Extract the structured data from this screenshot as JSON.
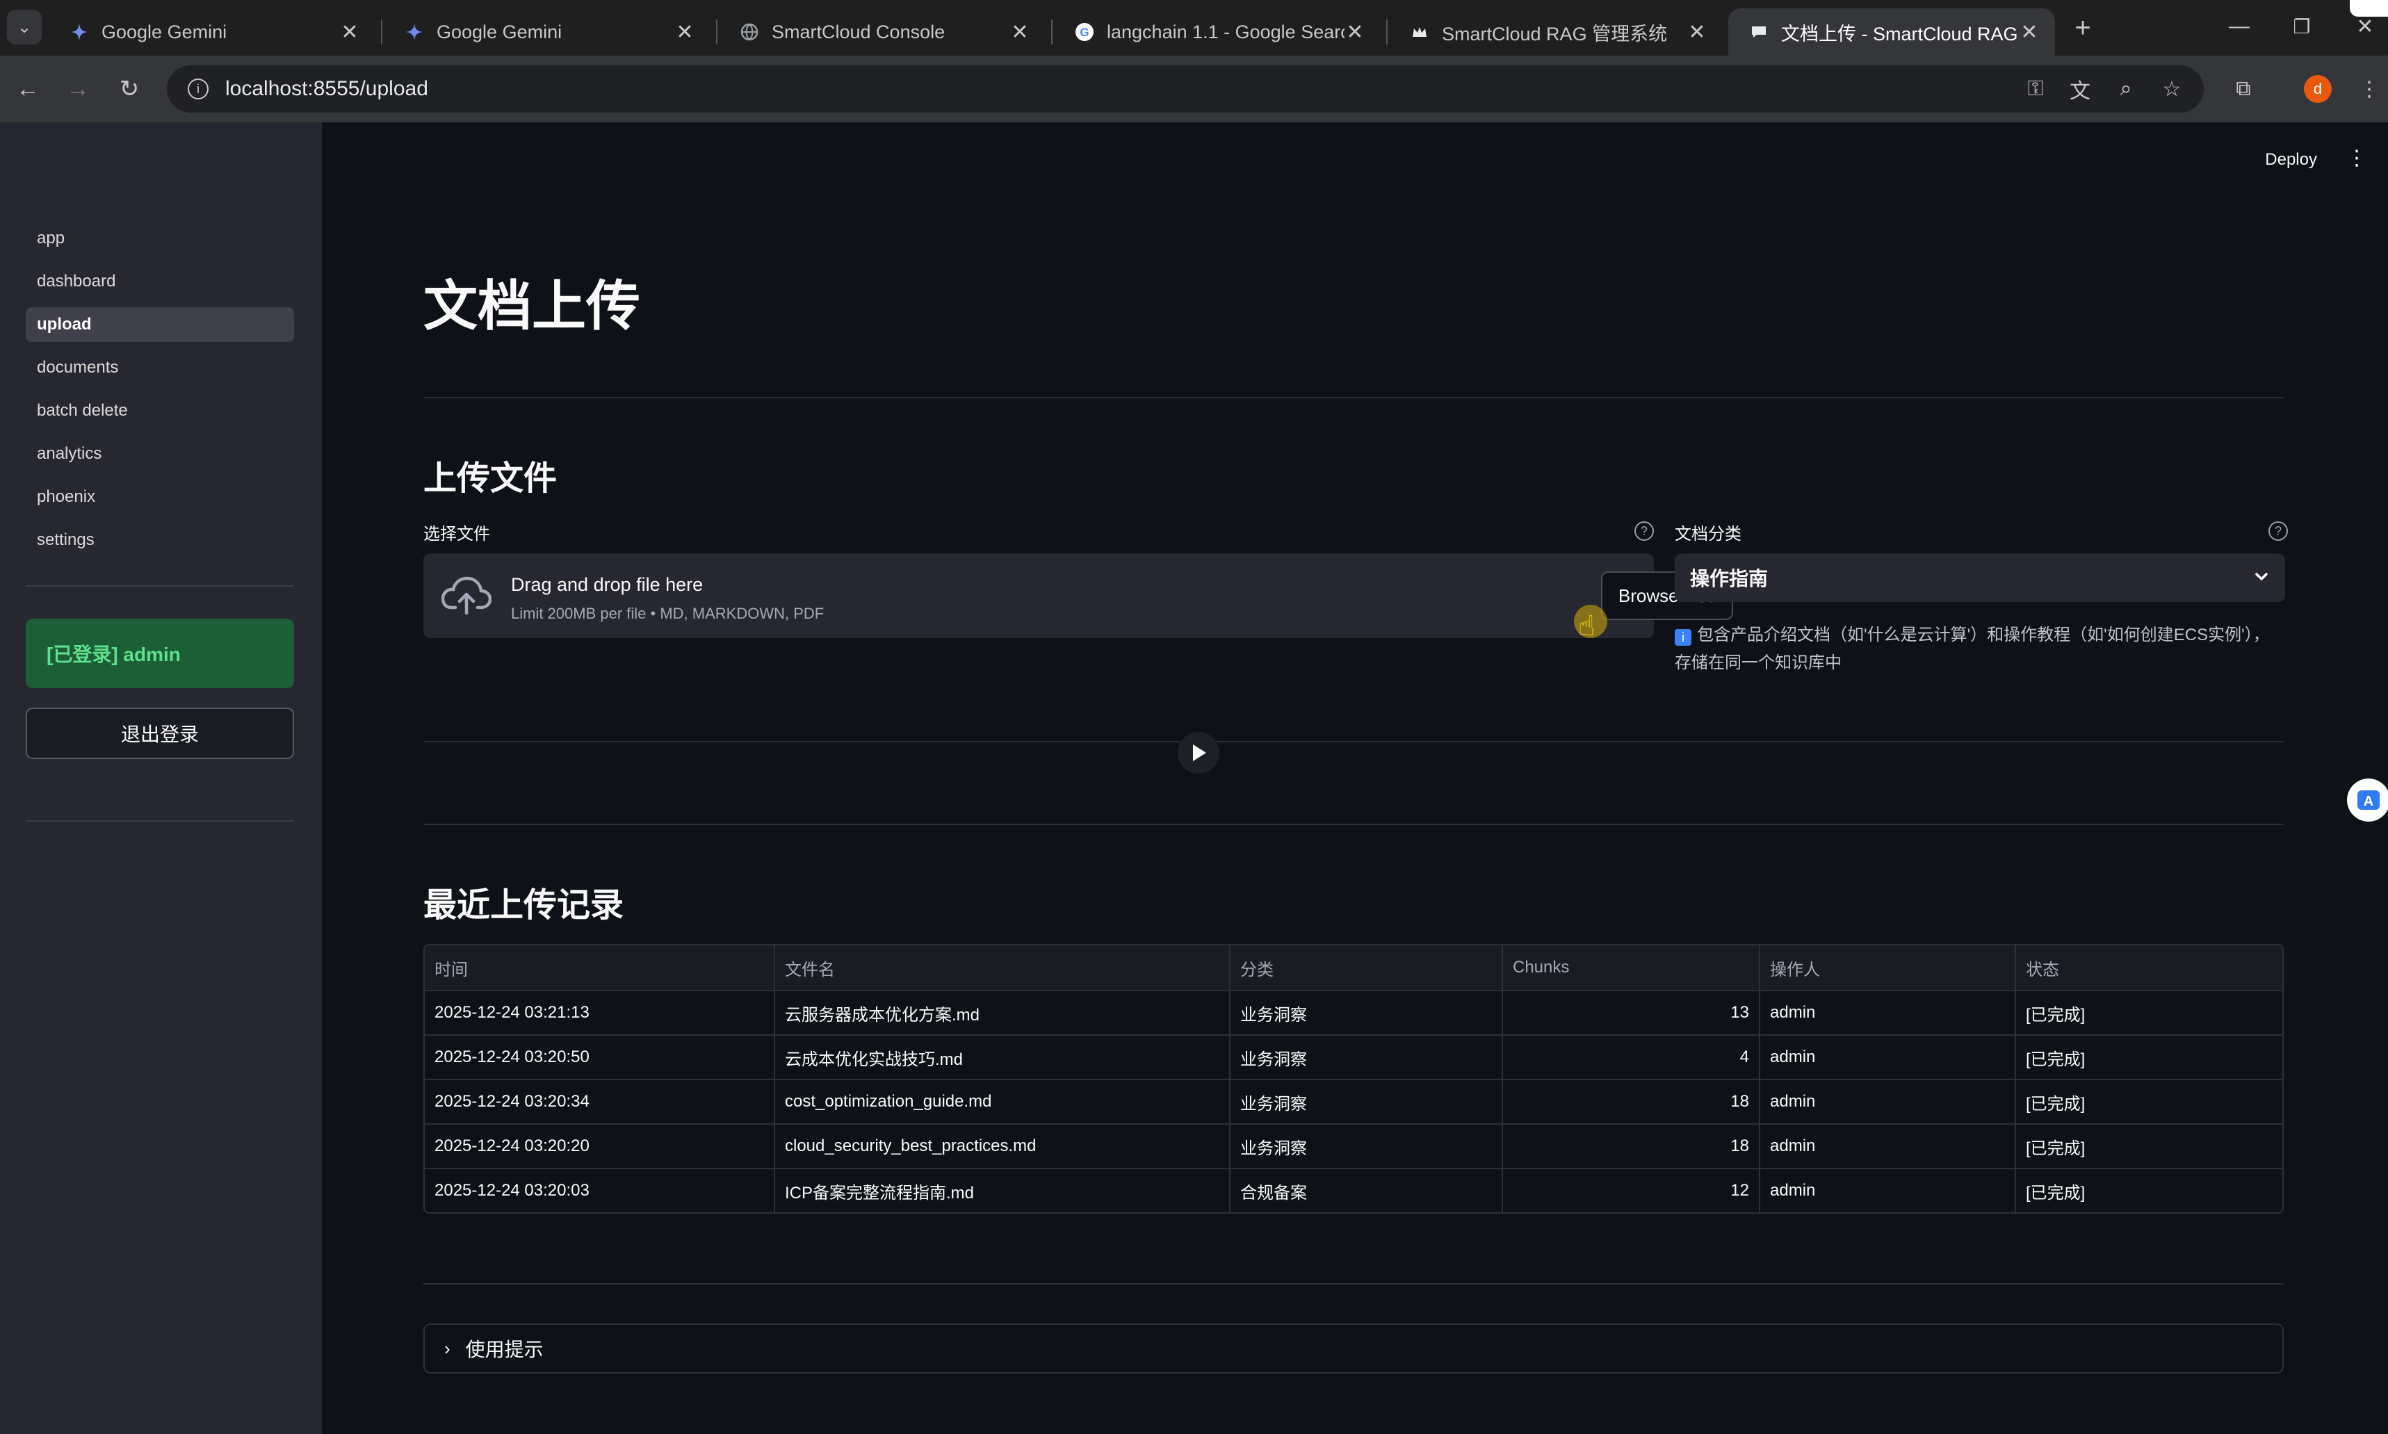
{
  "browser": {
    "tabs": [
      {
        "title": "Google Gemini",
        "icon": "gemini-icon"
      },
      {
        "title": "Google Gemini",
        "icon": "gemini-icon"
      },
      {
        "title": "SmartCloud Console",
        "icon": "globe-icon"
      },
      {
        "title": "langchain 1.1 - Google Searc",
        "icon": "google-icon"
      },
      {
        "title": "SmartCloud RAG 管理系统",
        "icon": "crown-icon"
      },
      {
        "title": "文档上传 - SmartCloud RAG",
        "icon": "chat-icon",
        "active": true
      }
    ],
    "url": "localhost:8555/upload",
    "profile_initial": "d",
    "profile_color": "#e8590c"
  },
  "sidebar": {
    "items": [
      {
        "label": "app"
      },
      {
        "label": "dashboard"
      },
      {
        "label": "upload",
        "active": true
      },
      {
        "label": "documents"
      },
      {
        "label": "batch delete"
      },
      {
        "label": "analytics"
      },
      {
        "label": "phoenix"
      },
      {
        "label": "settings"
      }
    ],
    "login_status": "[已登录] admin",
    "logout_label": "退出登录"
  },
  "header": {
    "deploy_label": "Deploy"
  },
  "main": {
    "page_title": "文档上传",
    "upload_section_title": "上传文件",
    "file_label": "选择文件",
    "dropzone_title": "Drag and drop file here",
    "dropzone_limit": "Limit 200MB per file • MD, MARKDOWN, PDF",
    "browse_label": "Browse files",
    "category_label": "文档分类",
    "category_value": "操作指南",
    "category_info": "包含产品介绍文档（如'什么是云计算'）和操作教程（如'如何创建ECS实例'），存储在同一个知识库中",
    "recent_title": "最近上传记录",
    "table": {
      "columns": [
        "时间",
        "文件名",
        "分类",
        "Chunks",
        "操作人",
        "状态"
      ],
      "rows": [
        [
          "2025-12-24 03:21:13",
          "云服务器成本优化方案.md",
          "业务洞察",
          "13",
          "admin",
          "[已完成]"
        ],
        [
          "2025-12-24 03:20:50",
          "云成本优化实战技巧.md",
          "业务洞察",
          "4",
          "admin",
          "[已完成]"
        ],
        [
          "2025-12-24 03:20:34",
          "cost_optimization_guide.md",
          "业务洞察",
          "18",
          "admin",
          "[已完成]"
        ],
        [
          "2025-12-24 03:20:20",
          "cloud_security_best_practices.md",
          "业务洞察",
          "18",
          "admin",
          "[已完成]"
        ],
        [
          "2025-12-24 03:20:03",
          "ICP备案完整流程指南.md",
          "合规备案",
          "12",
          "admin",
          "[已完成]"
        ]
      ]
    },
    "tips_label": "使用提示"
  }
}
